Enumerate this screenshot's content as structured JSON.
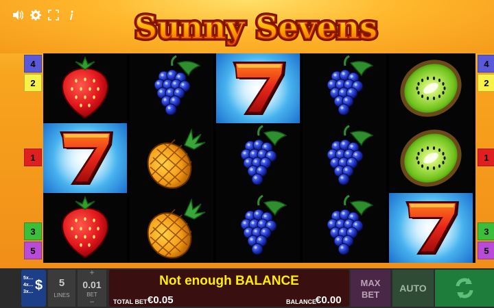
{
  "game": {
    "title": "Sunny Sevens"
  },
  "top_icons": [
    {
      "name": "sound-icon",
      "glyph": "🔊"
    },
    {
      "name": "settings-gear-icon",
      "glyph": "⚙"
    },
    {
      "name": "fullscreen-icon",
      "glyph": "⛶"
    },
    {
      "name": "info-icon",
      "glyph": "i"
    }
  ],
  "paylines_left": [
    {
      "label": "4",
      "color": "#5a5ad8"
    },
    {
      "label": "2",
      "color": "#f7f24a"
    },
    {
      "label": "1",
      "color": "#e02020"
    },
    {
      "label": "3",
      "color": "#3bbf3b"
    },
    {
      "label": "5",
      "color": "#b84cd8"
    }
  ],
  "paylines_right": [
    {
      "label": "4",
      "color": "#5a5ad8"
    },
    {
      "label": "2",
      "color": "#f7f24a"
    },
    {
      "label": "1",
      "color": "#e02020"
    },
    {
      "label": "3",
      "color": "#3bbf3b"
    },
    {
      "label": "5",
      "color": "#b84cd8"
    }
  ],
  "reels": [
    [
      "strawberry",
      "seven",
      "strawberry"
    ],
    [
      "blackberry",
      "pineapple",
      "pineapple"
    ],
    [
      "seven",
      "blackberry",
      "blackberry"
    ],
    [
      "blackberry",
      "blackberry",
      "blackberry"
    ],
    [
      "kiwi",
      "kiwi",
      "seven"
    ]
  ],
  "controls": {
    "paytable_lines": [
      "5x…",
      "4x…",
      "3x…"
    ],
    "paytable_symbol": "$",
    "lines_value": "5",
    "lines_label": "LINES",
    "bet_plus": "+",
    "bet_value": "0.01",
    "bet_label": "BET",
    "bet_minus": "−",
    "message": "Not enough BALANCE",
    "total_bet_label": "TOTAL BET",
    "total_bet_value": "€0.05",
    "balance_label": "BALANCE",
    "balance_value": "€0.00",
    "max_bet_line1": "MAX",
    "max_bet_line2": "BET",
    "auto_label": "AUTO"
  },
  "colors": {
    "spin_green": "#1e7d3a",
    "max_bet_purple": "#4b2747",
    "auto_green": "#2f4a35",
    "message_yellow": "#ffee00"
  }
}
